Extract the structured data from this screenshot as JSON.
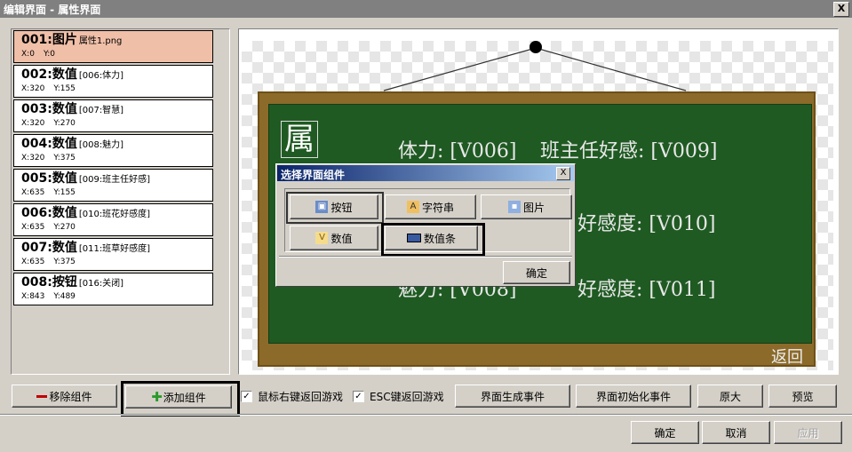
{
  "window": {
    "title": "编辑界面 - 属性界面",
    "close": "X"
  },
  "list": [
    {
      "num": "001:",
      "type": "图片",
      "param": "属性1.png",
      "x": "X:0",
      "y": "Y:0",
      "selected": true
    },
    {
      "num": "002:",
      "type": "数值",
      "param": "[006:体力]",
      "x": "X:320",
      "y": "Y:155"
    },
    {
      "num": "003:",
      "type": "数值",
      "param": "[007:智慧]",
      "x": "X:320",
      "y": "Y:270"
    },
    {
      "num": "004:",
      "type": "数值",
      "param": "[008:魅力]",
      "x": "X:320",
      "y": "Y:375"
    },
    {
      "num": "005:",
      "type": "数值",
      "param": "[009:班主任好感]",
      "x": "X:635",
      "y": "Y:155"
    },
    {
      "num": "006:",
      "type": "数值",
      "param": "[010:班花好感度]",
      "x": "X:635",
      "y": "Y:270"
    },
    {
      "num": "007:",
      "type": "数值",
      "param": "[011:班草好感度]",
      "x": "X:635",
      "y": "Y:375"
    },
    {
      "num": "008:",
      "type": "按钮",
      "param": "[016:关闭]",
      "x": "X:843",
      "y": "Y:489"
    }
  ],
  "preview": {
    "logo": "属",
    "line1_left": "体力: [V006]",
    "line1_right": "班主任好感: [V009]",
    "line2_right": "好感度: [V010]",
    "line3_left": "魅力: [V008]",
    "line3_right": "好感度: [V011]",
    "back": "返回"
  },
  "modal": {
    "title": "选择界面组件",
    "close": "X",
    "buttons": [
      "按钮",
      "字符串",
      "图片",
      "数值",
      "数值条"
    ],
    "confirm": "确定"
  },
  "toolbar": {
    "remove": "移除组件",
    "add": "添加组件",
    "chk_rightclick": "鼠标右键返回游戏",
    "chk_esc": "ESC键返回游戏",
    "gen_event": "界面生成事件",
    "init_event": "界面初始化事件",
    "original": "原大",
    "preview": "预览"
  },
  "footer": {
    "ok": "确定",
    "cancel": "取消",
    "apply": "应用"
  }
}
